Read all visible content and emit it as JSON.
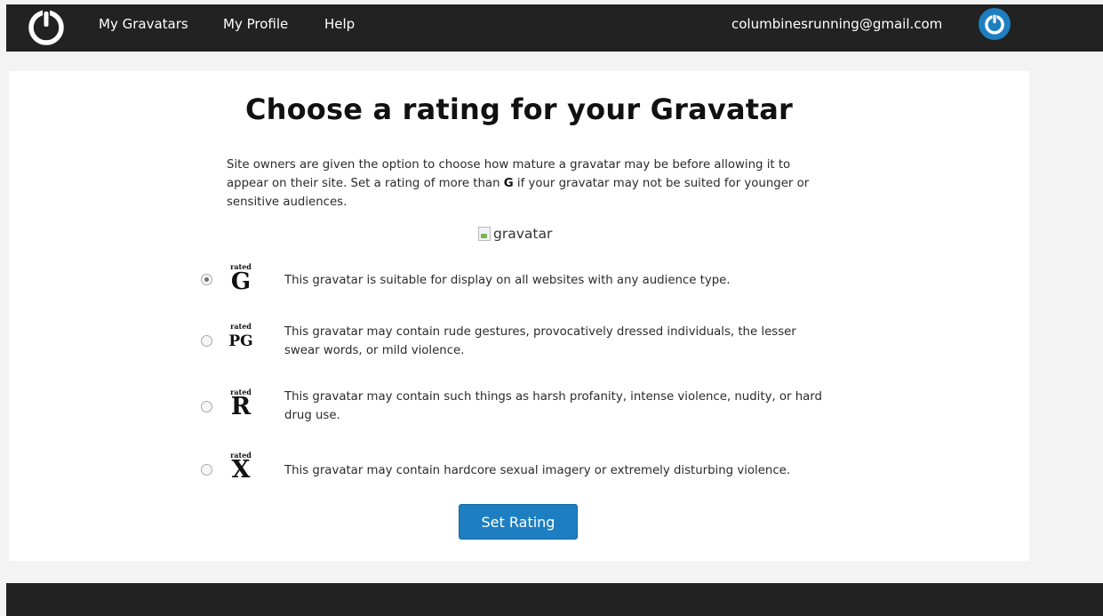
{
  "nav": {
    "items": [
      {
        "label": "My Gravatars"
      },
      {
        "label": "My Profile"
      },
      {
        "label": "Help"
      }
    ],
    "email": "columbinesrunning@gmail.com"
  },
  "page": {
    "title": "Choose a rating for your Gravatar",
    "description_before": "Site owners are given the option to choose how mature a gravatar may be before allowing it to appear on their site. Set a rating of more than ",
    "description_bold": "G",
    "description_after": " if your gravatar may not be suited for younger or sensitive audiences.",
    "gravatar_alt": "gravatar"
  },
  "ratings": [
    {
      "rated": "rated",
      "letter": "G",
      "text": "This gravatar is suitable for display on all websites with any audience type.",
      "selected": true
    },
    {
      "rated": "rated",
      "letter": "PG",
      "text": "This gravatar may contain rude gestures, provocatively dressed individuals, the lesser swear words, or mild violence.",
      "selected": false
    },
    {
      "rated": "rated",
      "letter": "R",
      "text": "This gravatar may contain such things as harsh profanity, intense violence, nudity, or hard drug use.",
      "selected": false
    },
    {
      "rated": "rated",
      "letter": "X",
      "text": "This gravatar may contain hardcore sexual imagery or extremely disturbing violence.",
      "selected": false
    }
  ],
  "actions": {
    "set_rating_label": "Set Rating"
  },
  "colors": {
    "topbar": "#222222",
    "accent": "#1d7fc1"
  }
}
